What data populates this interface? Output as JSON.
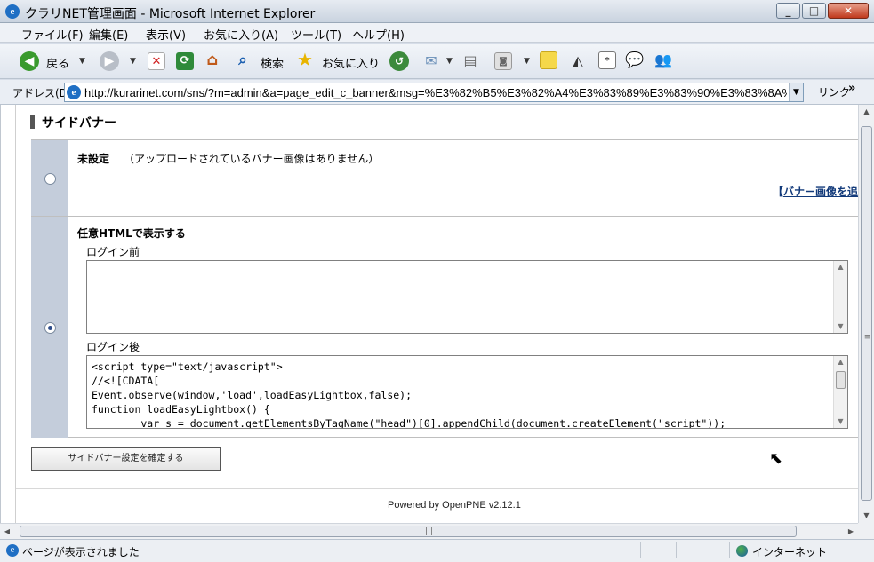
{
  "window": {
    "title": "クラリNET管理画面 - Microsoft Internet Explorer",
    "icon": "ie-icon"
  },
  "menu": [
    "ファイル(F)",
    "編集(E)",
    "表示(V)",
    "お気に入り(A)",
    "ツール(T)",
    "ヘルプ(H)"
  ],
  "toolbar": {
    "back_label": "戻る",
    "search_label": "検索",
    "favorites_label": "お気に入り"
  },
  "address": {
    "label": "アドレス(D)",
    "url": "http://kurarinet.com/sns/?m=admin&a=page_edit_c_banner&msg=%E3%82%B5%E3%82%A4%E3%83%89%E3%83%90%E3%83%8A%E",
    "links_label": "リンク",
    "links_chevron": "»"
  },
  "page": {
    "section_title": "サイドバナー",
    "option_unset": {
      "label": "未設定",
      "note": "（アップロードされているバナー画像はありません）",
      "selected": false
    },
    "add_banner_bracket": "【",
    "add_banner_link": "バナー画像を追",
    "option_html": {
      "label": "任意HTMLで表示する",
      "selected": true
    },
    "pre_login_label": "ログイン前",
    "pre_login_value": "",
    "post_login_label": "ログイン後",
    "post_login_value": "<script type=\"text/javascript\">\n//<![CDATA[\nEvent.observe(window,'load',loadEasyLightbox,false);\nfunction loadEasyLightbox() {\n        var s = document.getElementsByTagName(\"head\")[0].appendChild(document.createElement(\"script\"));",
    "confirm_button": "サイドバナー設定を確定する",
    "powered_by": "Powered by OpenPNE v2.12.1"
  },
  "status": {
    "text": "ページが表示されました",
    "zone": "インターネット"
  },
  "colors": {
    "radio_column": "#c4cddb",
    "link": "#123a7a"
  }
}
